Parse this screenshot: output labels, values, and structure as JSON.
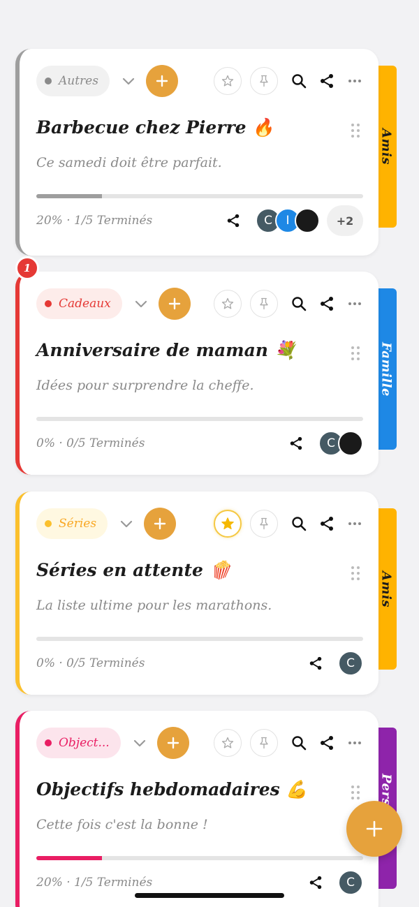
{
  "cards": [
    {
      "category": "Autres",
      "title": "Barbecue chez Pierre 🔥",
      "description": "Ce samedi doit être parfait.",
      "progress_text": "20% · 1/5 Terminés",
      "progress": 0.2,
      "group": "Amis",
      "starred": false,
      "avatars": [
        "C",
        "I",
        ""
      ],
      "extra_members": "+2",
      "colors": {
        "accent": "#9e9e9e",
        "pill_bg": "#f1f1f1",
        "pill_text": "#8a8a8a",
        "tab": "#ffb300",
        "tab_text": "#1c1c1c"
      }
    },
    {
      "category": "Cadeaux",
      "badge": "1",
      "title": "Anniversaire de maman 💐",
      "description": "Idées pour surprendre la cheffe.",
      "progress_text": "0% · 0/5 Terminés",
      "progress": 0,
      "group": "Famille",
      "starred": false,
      "avatars": [
        "C",
        ""
      ],
      "colors": {
        "accent": "#e53935",
        "pill_bg": "#fdecea",
        "pill_text": "#e53935",
        "tab": "#1e88e5",
        "tab_text": "#ffffff"
      }
    },
    {
      "category": "Séries",
      "title": "Séries en attente 🍿",
      "description": "La liste ultime pour les marathons.",
      "progress_text": "0% · 0/5 Terminés",
      "progress": 0,
      "group": "Amis",
      "starred": true,
      "avatars": [
        "C"
      ],
      "colors": {
        "accent": "#fbc02d",
        "pill_bg": "#fff8e1",
        "pill_text": "#f9a825",
        "tab": "#ffb300",
        "tab_text": "#1c1c1c"
      }
    },
    {
      "category": "Object...",
      "title": "Objectifs hebdomadaires 💪",
      "description": "Cette fois c'est la bonne !",
      "progress_text": "20% · 1/5 Terminés",
      "progress": 0.2,
      "group": "Pers",
      "starred": false,
      "avatars": [
        "C"
      ],
      "colors": {
        "accent": "#e91e63",
        "pill_bg": "#fce4ec",
        "pill_text": "#e91e63",
        "tab": "#8e24aa",
        "tab_text": "#ffffff"
      }
    }
  ],
  "avatar_colors": {
    "C": "#455a64",
    "I": "#1e88e5",
    "dark": "#1a1a1a"
  }
}
